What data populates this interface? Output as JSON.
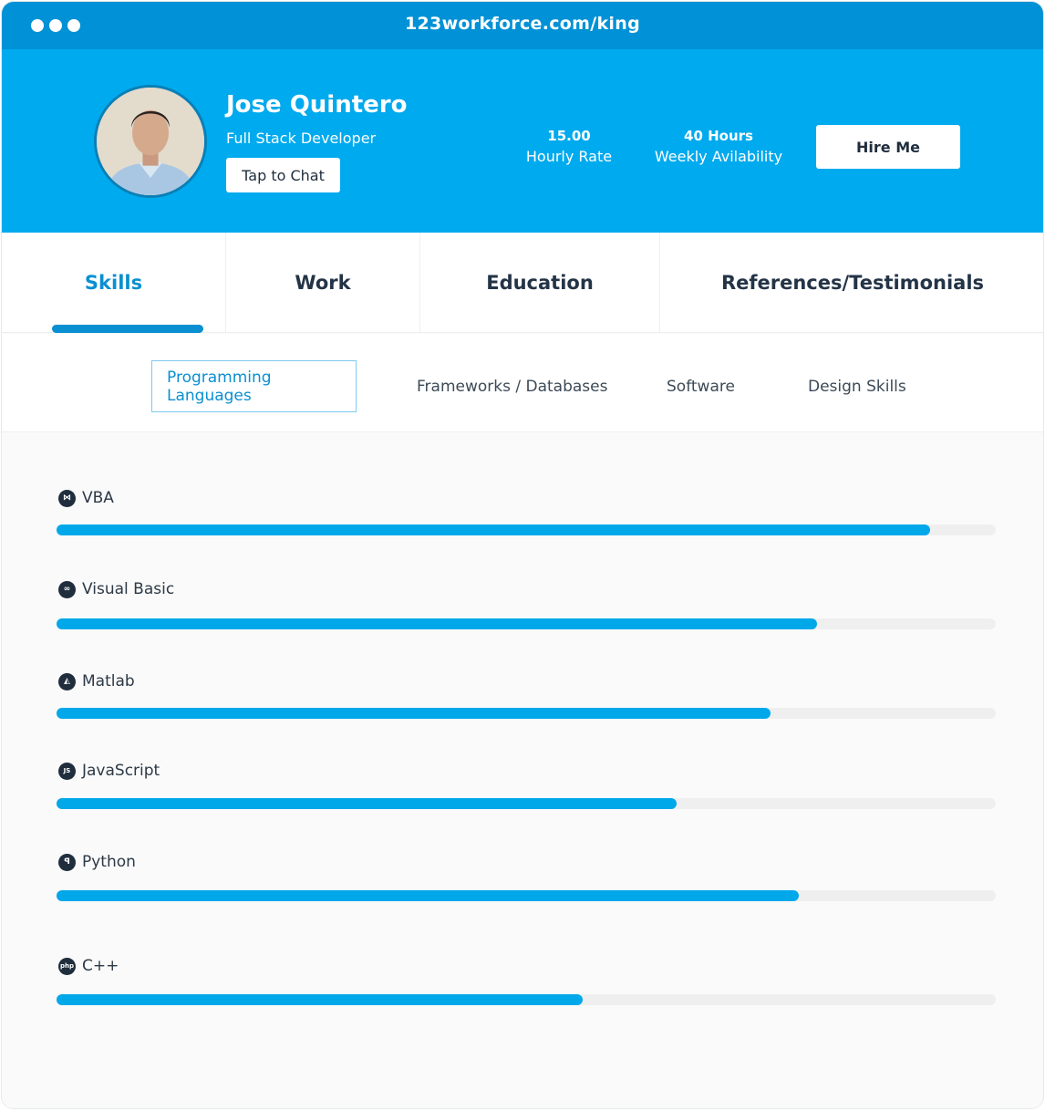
{
  "browser": {
    "url": "123workforce.com/king"
  },
  "profile": {
    "name": "Jose Quintero",
    "role": "Full Stack Developer",
    "chat_label": "Tap to Chat",
    "hourly_rate_value": "15.00",
    "hourly_rate_label": "Hourly Rate",
    "availability_value": "40 Hours",
    "availability_label": "Weekly Avilability",
    "hire_label": "Hire Me"
  },
  "tabs": [
    {
      "label": "Skills",
      "active": true
    },
    {
      "label": "Work",
      "active": false
    },
    {
      "label": "Education",
      "active": false
    },
    {
      "label": "References/Testimonials",
      "active": false
    }
  ],
  "subtabs": [
    {
      "label": "Programming Languages",
      "active": true
    },
    {
      "label": "Frameworks / Databases",
      "active": false
    },
    {
      "label": "Software",
      "active": false
    },
    {
      "label": "Design Skills",
      "active": false
    }
  ],
  "skills": [
    {
      "name": "VBA",
      "icon": "visual-studio-icon",
      "glyph": "⋈",
      "level": 0.93
    },
    {
      "name": "Visual Basic",
      "icon": "infinity-icon",
      "glyph": "∞",
      "level": 0.81
    },
    {
      "name": "Matlab",
      "icon": "matlab-icon",
      "glyph": "◭",
      "level": 0.76
    },
    {
      "name": "JavaScript",
      "icon": "js-icon",
      "glyph": "JS",
      "level": 0.66
    },
    {
      "name": "Python",
      "icon": "python-icon",
      "glyph": "ꟼ",
      "level": 0.79
    },
    {
      "name": "C++",
      "icon": "php-icon",
      "glyph": "php",
      "level": 0.56
    }
  ],
  "colors": {
    "header": "#00aaee",
    "titlebar": "#0091d6",
    "accent": "#0a8fd0",
    "bar_fill": "#00a8ea",
    "bar_track": "#efefef"
  }
}
